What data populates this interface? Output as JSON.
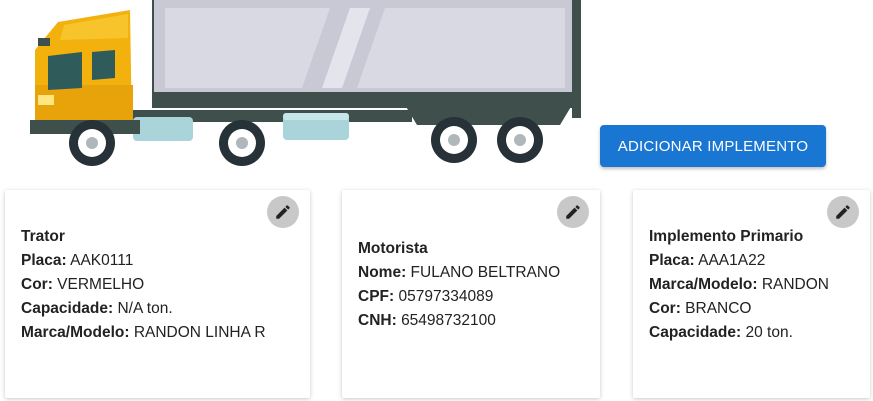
{
  "add_button_label": "ADICIONAR IMPLEMENTO",
  "colors": {
    "primary": "#1976d2",
    "edit_button_bg": "#c8c8c8"
  },
  "illustration": "truck-with-trailer",
  "cards": {
    "trator": {
      "title": "Trator",
      "fields": [
        {
          "label": "Placa:",
          "value": "AAK0111"
        },
        {
          "label": "Cor:",
          "value": "VERMELHO"
        },
        {
          "label": "Capacidade:",
          "value": "N/A ton."
        },
        {
          "label": "Marca/Modelo:",
          "value": "RANDON LINHA R"
        }
      ]
    },
    "motorista": {
      "title": "Motorista",
      "fields": [
        {
          "label": "Nome:",
          "value": "FULANO BELTRANO"
        },
        {
          "label": "CPF:",
          "value": "05797334089"
        },
        {
          "label": "CNH:",
          "value": "65498732100"
        }
      ]
    },
    "implemento": {
      "title": "Implemento Primario",
      "fields": [
        {
          "label": "Placa:",
          "value": "AAA1A22"
        },
        {
          "label": "Marca/Modelo:",
          "value": "RANDON"
        },
        {
          "label": "Cor:",
          "value": "BRANCO"
        },
        {
          "label": "Capacidade:",
          "value": "20 ton."
        }
      ]
    }
  }
}
